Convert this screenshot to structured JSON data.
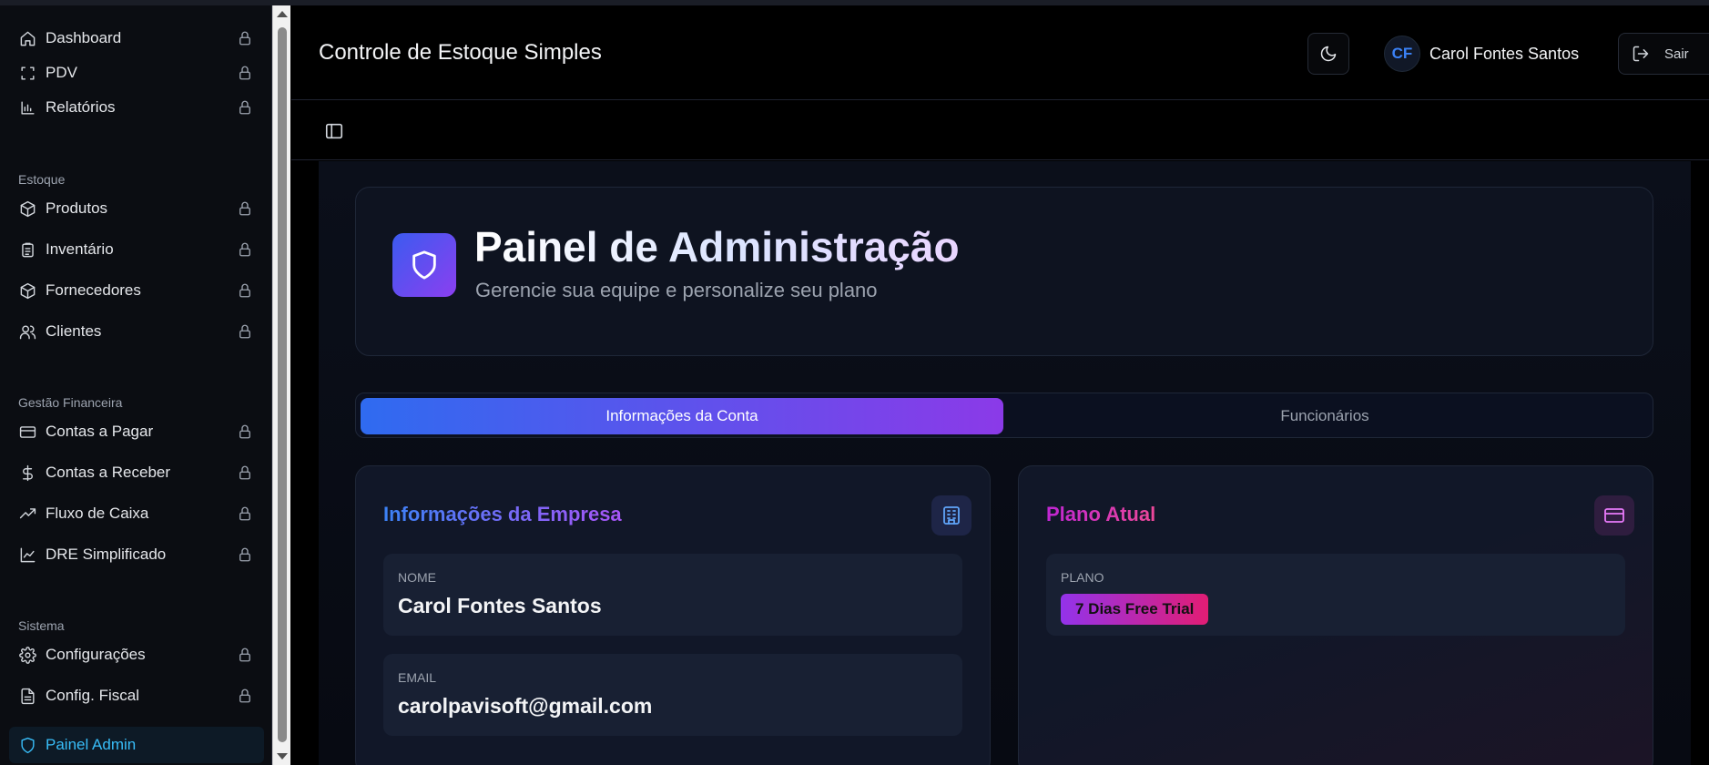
{
  "app": {
    "title": "Controle de Estoque Simples"
  },
  "header": {
    "user_initials": "CF",
    "user_name": "Carol Fontes Santos",
    "logout_label": "Sair"
  },
  "sidebar": {
    "items": [
      {
        "label": "Dashboard",
        "icon": "home-icon",
        "locked": true
      },
      {
        "label": "PDV",
        "icon": "scan-icon",
        "locked": true
      },
      {
        "label": "Relatórios",
        "icon": "bar-chart-icon",
        "locked": true
      },
      {
        "label": "Produtos",
        "icon": "package-icon",
        "locked": true
      },
      {
        "label": "Inventário",
        "icon": "clipboard-icon",
        "locked": true
      },
      {
        "label": "Fornecedores",
        "icon": "package-icon",
        "locked": true
      },
      {
        "label": "Clientes",
        "icon": "users-icon",
        "locked": true
      },
      {
        "label": "Contas a Pagar",
        "icon": "credit-card-icon",
        "locked": true
      },
      {
        "label": "Contas a Receber",
        "icon": "dollar-icon",
        "locked": true
      },
      {
        "label": "Fluxo de Caixa",
        "icon": "trending-up-icon",
        "locked": true
      },
      {
        "label": "DRE Simplificado",
        "icon": "line-chart-icon",
        "locked": true
      },
      {
        "label": "Configurações",
        "icon": "gear-icon",
        "locked": true
      },
      {
        "label": "Config. Fiscal",
        "icon": "file-icon",
        "locked": true
      },
      {
        "label": "Painel Admin",
        "icon": "shield-icon",
        "locked": false,
        "active": true
      }
    ],
    "sections": {
      "estoque": "Estoque",
      "financeira": "Gestão Financeira",
      "sistema": "Sistema"
    }
  },
  "hero": {
    "title": "Painel de Administração",
    "subtitle": "Gerencie sua equipe e personalize seu plano"
  },
  "tabs": [
    {
      "label": "Informações da Conta",
      "active": true
    },
    {
      "label": "Funcionários",
      "active": false
    }
  ],
  "company_card": {
    "title": "Informações da Empresa",
    "name_label": "NOME",
    "name_value": "Carol Fontes Santos",
    "email_label": "EMAIL",
    "email_value": "carolpavisoft@gmail.com"
  },
  "plan_card": {
    "title": "Plano Atual",
    "plan_label": "PLANO",
    "plan_value": "7 Dias Free Trial"
  },
  "colors": {
    "accent_blue": "#2f6bf0",
    "accent_purple": "#8b3ae8",
    "active_nav": "#38bdf8",
    "badge_pink": "#e11d74"
  }
}
